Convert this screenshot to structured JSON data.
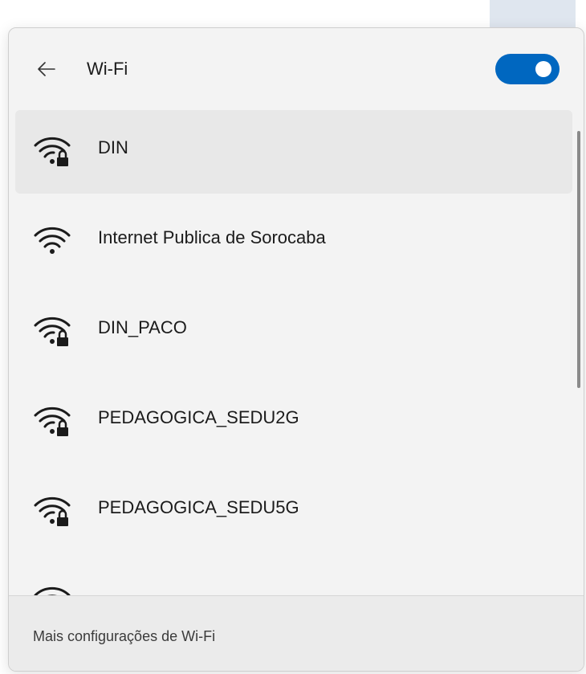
{
  "header": {
    "title": "Wi-Fi",
    "back_icon": "back-arrow-icon",
    "toggle": {
      "state": "on",
      "color": "#0067c0"
    }
  },
  "networks": [
    {
      "name": "DIN",
      "secured": true,
      "selected": true
    },
    {
      "name": "Internet Publica de Sorocaba",
      "secured": false,
      "selected": false
    },
    {
      "name": "DIN_PACO",
      "secured": true,
      "selected": false
    },
    {
      "name": "PEDAGOGICA_SEDU2G",
      "secured": true,
      "selected": false
    },
    {
      "name": "PEDAGOGICA_SEDU5G",
      "secured": true,
      "selected": false
    },
    {
      "name": "",
      "secured": false,
      "selected": false,
      "partially_visible": true
    }
  ],
  "footer": {
    "link_label": "Mais configurações de Wi-Fi"
  },
  "icons": {
    "wifi": "wifi-signal-icon",
    "lock": "lock-icon"
  }
}
